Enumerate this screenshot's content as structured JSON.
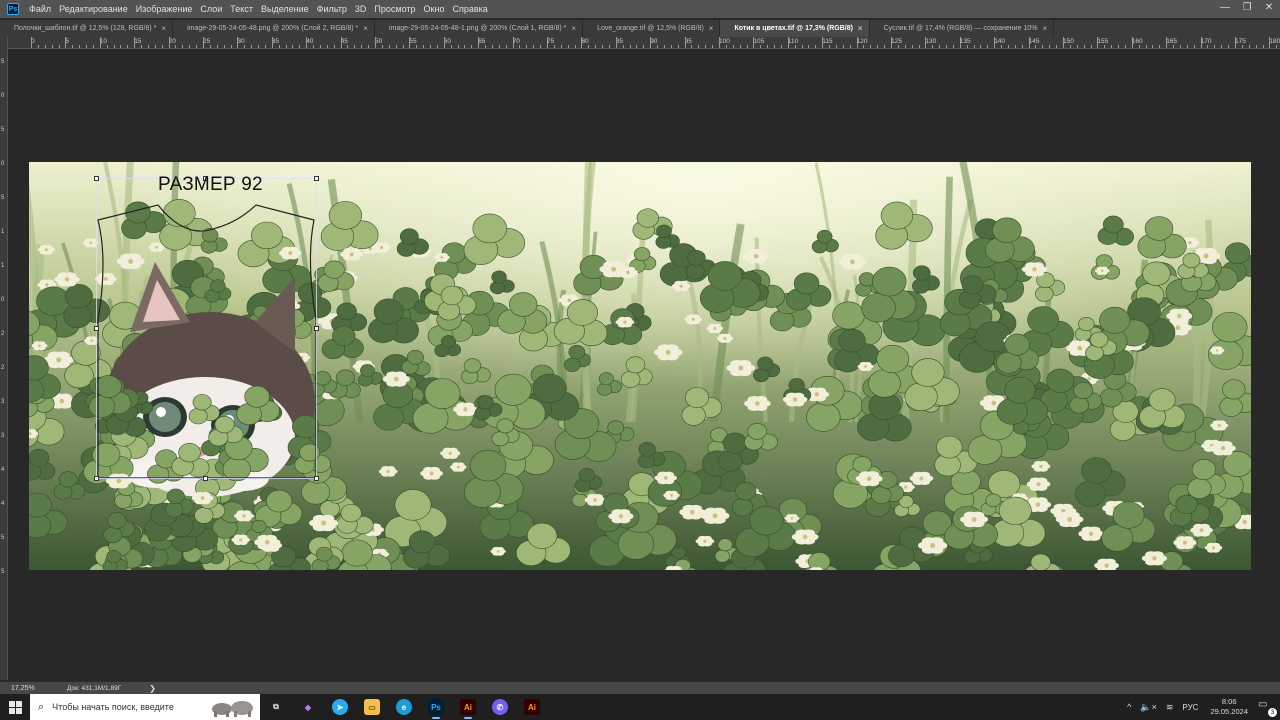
{
  "app": {
    "logo": "Ps"
  },
  "menu": [
    "Файл",
    "Редактирование",
    "Изображение",
    "Слои",
    "Текст",
    "Выделение",
    "Фильтр",
    "3D",
    "Просмотр",
    "Окно",
    "Справка"
  ],
  "window_controls": {
    "minimize": "—",
    "restore": "❐",
    "close": "✕"
  },
  "tabs": [
    {
      "label": "Полочки_шаблон.tif @ 12,5% (128, RGB/8) *",
      "active": false
    },
    {
      "label": "image-29-05-24-05-48.png @ 200% (Слой 2, RGB/8) *",
      "active": false
    },
    {
      "label": "image-29-05-24-05-48-1.png @ 200% (Слой 1, RGB/8) *",
      "active": false
    },
    {
      "label": "Love_orange.tif @ 12,5% (RGB/8)",
      "active": false
    },
    {
      "label": "Котик в цветах.tif @ 17,3% (RGB/8)",
      "active": true
    },
    {
      "label": "Суслик.tif @ 17,4% (RGB/8) — сохранение 10%",
      "active": false
    }
  ],
  "tab_close": "×",
  "ruler_top_labels": [
    "0",
    "5",
    "10",
    "15",
    "20",
    "25",
    "30",
    "35",
    "40",
    "45",
    "50",
    "55",
    "60",
    "65",
    "70",
    "75",
    "80",
    "85",
    "90",
    "95",
    "100",
    "105",
    "110",
    "115",
    "120",
    "125",
    "130",
    "135",
    "140",
    "145",
    "150",
    "155",
    "160",
    "165",
    "170",
    "175",
    "180"
  ],
  "ruler_left_labels": [
    "5",
    "0",
    "5",
    "0",
    "5",
    "1",
    "1",
    "0",
    "2",
    "2",
    "3",
    "3",
    "4",
    "4",
    "5",
    "5"
  ],
  "canvas": {
    "size_label": "РАЗМЕР 92",
    "colors": {
      "grass_dark": "#3f5a35",
      "grass_mid": "#6f8f55",
      "grass_light": "#a9bd82",
      "sky": "#e6e7bf",
      "flower": "#f1efd9"
    }
  },
  "status": {
    "zoom": "17,25%",
    "doc": "Док: 431,1M/1,89Г",
    "arrow": "❯"
  },
  "taskbar": {
    "search_placeholder": "Чтобы начать поиск, введите",
    "apps": [
      {
        "name": "task-view",
        "glyph": "⧉",
        "running": false
      },
      {
        "name": "copilot",
        "glyph": "◆",
        "running": false
      },
      {
        "name": "telegram",
        "glyph": "➤",
        "running": false
      },
      {
        "name": "file-explorer",
        "glyph": "▭",
        "running": false
      },
      {
        "name": "edge",
        "glyph": "e",
        "running": false
      },
      {
        "name": "photoshop",
        "glyph": "Ps",
        "running": true
      },
      {
        "name": "illustrator",
        "glyph": "Ai",
        "running": true
      },
      {
        "name": "viber",
        "glyph": "✆",
        "running": false
      },
      {
        "name": "illustrator-2",
        "glyph": "Ai",
        "running": false
      }
    ],
    "tray": {
      "chevron": "^",
      "sound": "🔈×",
      "wifi": "≋",
      "lang": "РУС"
    },
    "clock": {
      "time": "8:06",
      "date": "29.05.2024"
    },
    "notifications": "3"
  }
}
